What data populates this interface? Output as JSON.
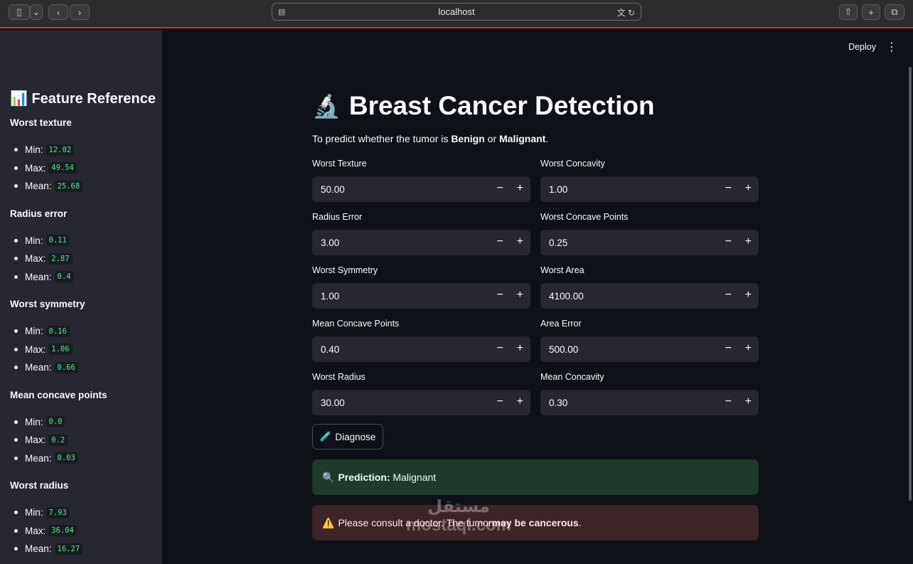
{
  "browser": {
    "url": "localhost"
  },
  "header": {
    "deploy_label": "Deploy"
  },
  "sidebar": {
    "title": "📊 Feature Reference",
    "features": [
      {
        "name": "Worst texture",
        "min": "12.02",
        "max": "49.54",
        "mean": "25.68"
      },
      {
        "name": "Radius error",
        "min": "0.11",
        "max": "2.87",
        "mean": "0.4"
      },
      {
        "name": "Worst symmetry",
        "min": "0.16",
        "max": "1.06",
        "mean": "0.66"
      },
      {
        "name": "Mean concave points",
        "min": "0.0",
        "max": "0.2",
        "mean": "0.03"
      },
      {
        "name": "Worst radius",
        "min": "7.93",
        "max": "36.04",
        "mean": "16.27"
      }
    ],
    "labels": {
      "min": "Min:",
      "max": "Max:",
      "mean": "Mean:"
    }
  },
  "main": {
    "title_emoji": "🔬",
    "title": "Breast Cancer Detection",
    "subtitle_pre": "To predict whether the tumor is ",
    "subtitle_b1": "Benign",
    "subtitle_mid": " or ",
    "subtitle_b2": "Malignant",
    "subtitle_post": ".",
    "inputs": [
      {
        "label": "Worst Texture",
        "value": "50.00"
      },
      {
        "label": "Worst Concavity",
        "value": "1.00"
      },
      {
        "label": "Radius Error",
        "value": "3.00"
      },
      {
        "label": "Worst Concave Points",
        "value": "0.25"
      },
      {
        "label": "Worst Symmetry",
        "value": "1.00"
      },
      {
        "label": "Worst Area",
        "value": "4100.00"
      },
      {
        "label": "Mean Concave Points",
        "value": "0.40"
      },
      {
        "label": "Area Error",
        "value": "500.00"
      },
      {
        "label": "Worst Radius",
        "value": "30.00"
      },
      {
        "label": "Mean Concavity",
        "value": "0.30"
      }
    ],
    "diagnose_label": "Diagnose",
    "prediction_label": "Prediction:",
    "prediction_value": "Malignant",
    "warning_pre": "Please consult a doctor. The tumor ",
    "warning_bold": "may be cancerous",
    "warning_post": "."
  },
  "watermark": {
    "arabic": "مستقل",
    "latin": "mostaql.com"
  }
}
